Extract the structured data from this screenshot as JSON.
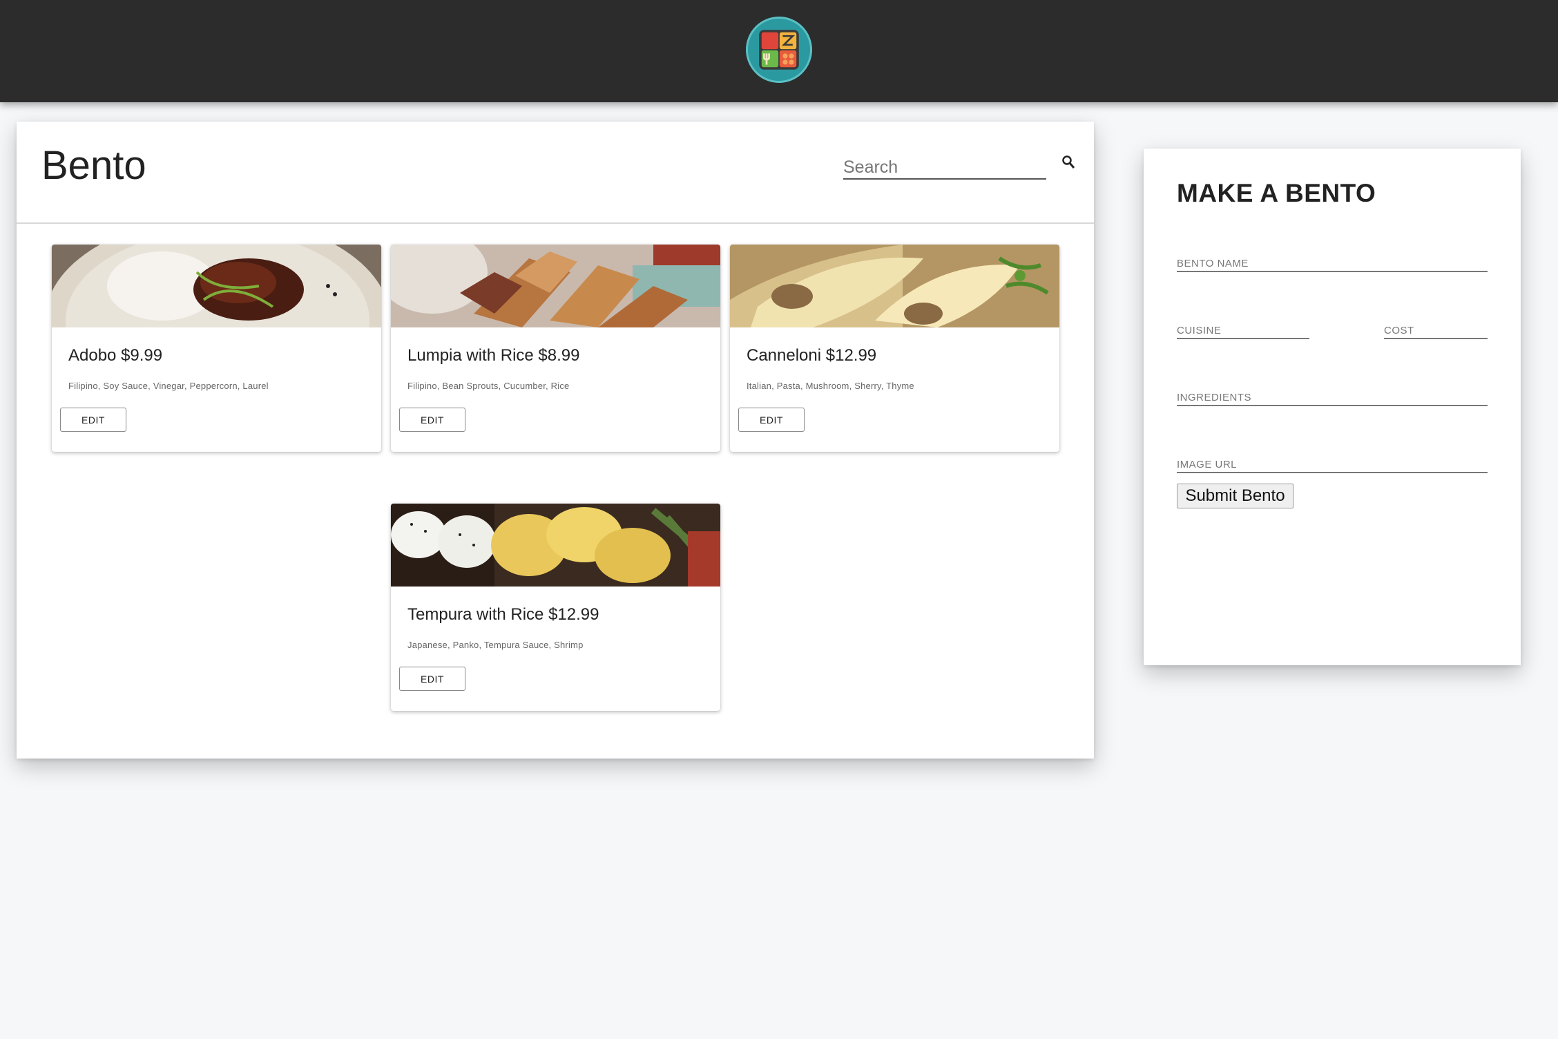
{
  "header": {
    "logo_name": "bento-logo"
  },
  "list": {
    "title": "Bento",
    "search_placeholder": "Search"
  },
  "bentos": [
    {
      "title": "Adobo $9.99",
      "ingredients": "Filipino, Soy Sauce, Vinegar, Peppercorn, Laurel",
      "edit_label": "EDIT",
      "image_theme": "adobo"
    },
    {
      "title": "Lumpia with Rice $8.99",
      "ingredients": "Filipino, Bean Sprouts, Cucumber, Rice",
      "edit_label": "EDIT",
      "image_theme": "lumpia"
    },
    {
      "title": "Canneloni $12.99",
      "ingredients": "Italian, Pasta, Mushroom, Sherry, Thyme",
      "edit_label": "EDIT",
      "image_theme": "canneloni"
    },
    {
      "title": "Tempura with Rice $12.99",
      "ingredients": "Japanese, Panko, Tempura Sauce, Shrimp",
      "edit_label": "EDIT",
      "image_theme": "tempura"
    }
  ],
  "form": {
    "title": "MAKE A BENTO",
    "name_placeholder": "BENTO NAME",
    "cuisine_placeholder": "CUISINE",
    "cost_placeholder": "COST",
    "ingredients_placeholder": "INGREDIENTS",
    "image_url_placeholder": "IMAGE URL",
    "submit_label": "Submit Bento"
  },
  "colors": {
    "topbar": "#2c2c2c",
    "page_background": "#f5f7f9",
    "card_background": "#ffffff",
    "logo_teal": "#2b9aa0"
  }
}
